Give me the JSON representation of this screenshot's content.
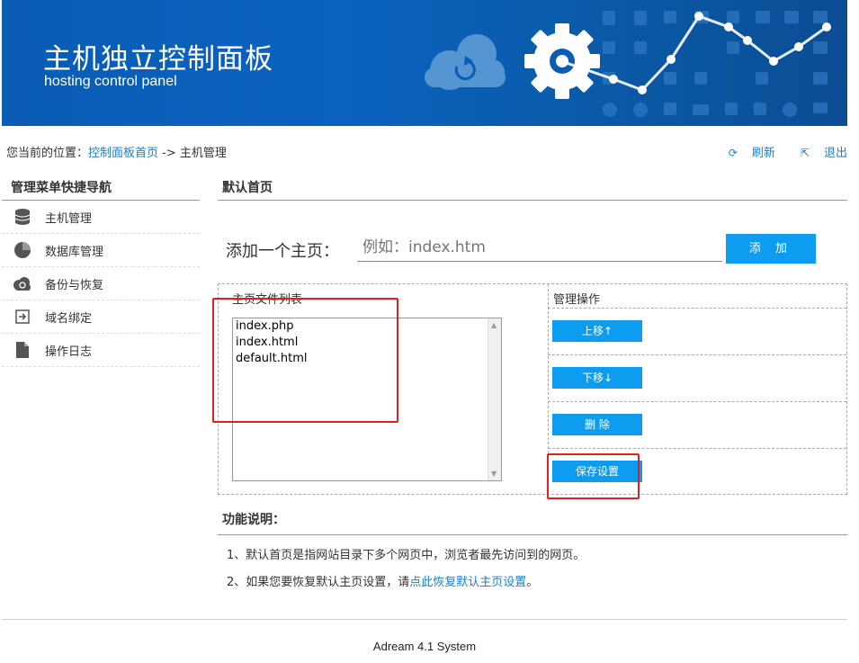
{
  "header": {
    "title_cn": "主机独立控制面板",
    "title_en": "hosting control panel"
  },
  "breadcrumb": {
    "prefix": "您当前的位置：",
    "home_link": "控制面板首页",
    "separator": " -> ",
    "current": "主机管理"
  },
  "top_actions": {
    "refresh_icon": "refresh-icon",
    "refresh_label": "刷新",
    "logout_icon": "logout-icon",
    "logout_label": "退出"
  },
  "sidebar": {
    "heading": "管理菜单快捷导航",
    "items": [
      {
        "label": "主机管理",
        "icon": "database-icon"
      },
      {
        "label": "数据库管理",
        "icon": "pie-chart-icon"
      },
      {
        "label": "备份与恢复",
        "icon": "cloud-sync-icon"
      },
      {
        "label": "域名绑定",
        "icon": "arrow-in-icon"
      },
      {
        "label": "操作日志",
        "icon": "document-icon"
      }
    ]
  },
  "main": {
    "section_title": "默认首页",
    "add_label": "添加一个主页：",
    "add_placeholder": "例如：index.htm",
    "add_button": "添 加",
    "table": {
      "col_files": "主页文件列表",
      "col_ops": "管理操作",
      "files": [
        "index.php",
        "index.html",
        "default.html"
      ],
      "buttons": {
        "up": "上移↑",
        "down": "下移↓",
        "delete": "删 除",
        "save": "保存设置"
      }
    }
  },
  "help": {
    "title": "功能说明：",
    "line1": "1、默认首页是指网站目录下多个网页中，浏览者最先访问到的网页。",
    "line2_prefix": "2、如果您要恢复默认主页设置，请",
    "line2_link": "点此恢复默认主页设置",
    "line2_suffix": "。"
  },
  "footer": {
    "text": "Adream 4.1 System"
  },
  "colors": {
    "banner_blue": "#0a5cb4",
    "button_blue": "#0e9cf0",
    "link_blue": "#1a7fd0",
    "highlight_red": "#e02020"
  }
}
